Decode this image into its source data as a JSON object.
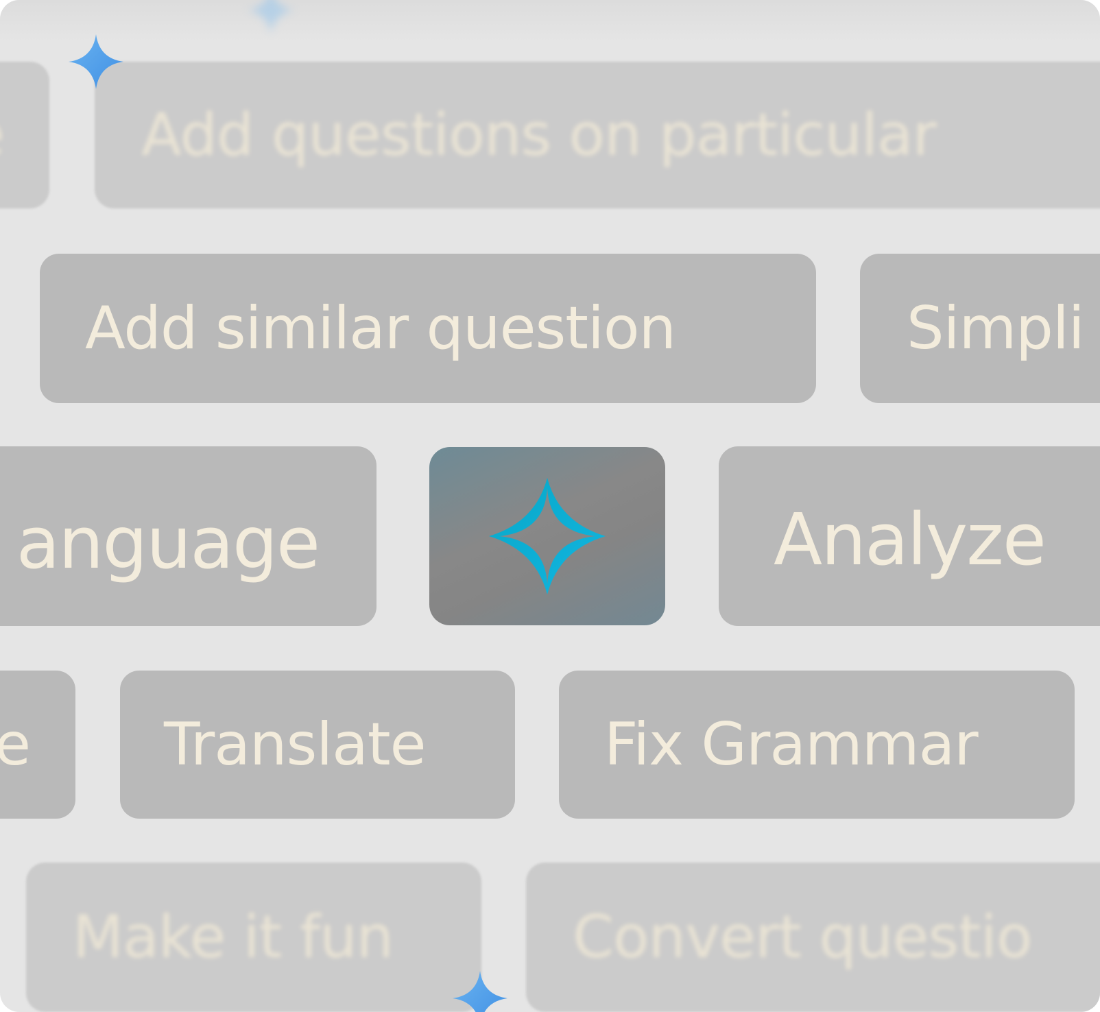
{
  "colors": {
    "background": "#e5e5e5",
    "chip": "#b9b9b9",
    "chip_faded": "#cbcbcb",
    "label": "#f3ecdc",
    "ai_icon": "#0fb1d6",
    "sparkle": "#5aa6ec"
  },
  "rows": {
    "row1": {
      "left_fragment": "e",
      "chip": "Add questions on particular"
    },
    "row2": {
      "chip1": "Add similar question",
      "chip2": "Simpli"
    },
    "row3": {
      "left_fragment": "anguage",
      "ai_button_icon": "ai-sparkle-icon",
      "right_chip": "Analyze"
    },
    "row4": {
      "left_fragment": "e",
      "chip1": "Translate",
      "chip2": "Fix Grammar"
    },
    "row5": {
      "chip1": "Make it fun",
      "chip2": "Convert questio"
    }
  },
  "icons": [
    "sparkle-icon",
    "ai-sparkle-icon"
  ]
}
